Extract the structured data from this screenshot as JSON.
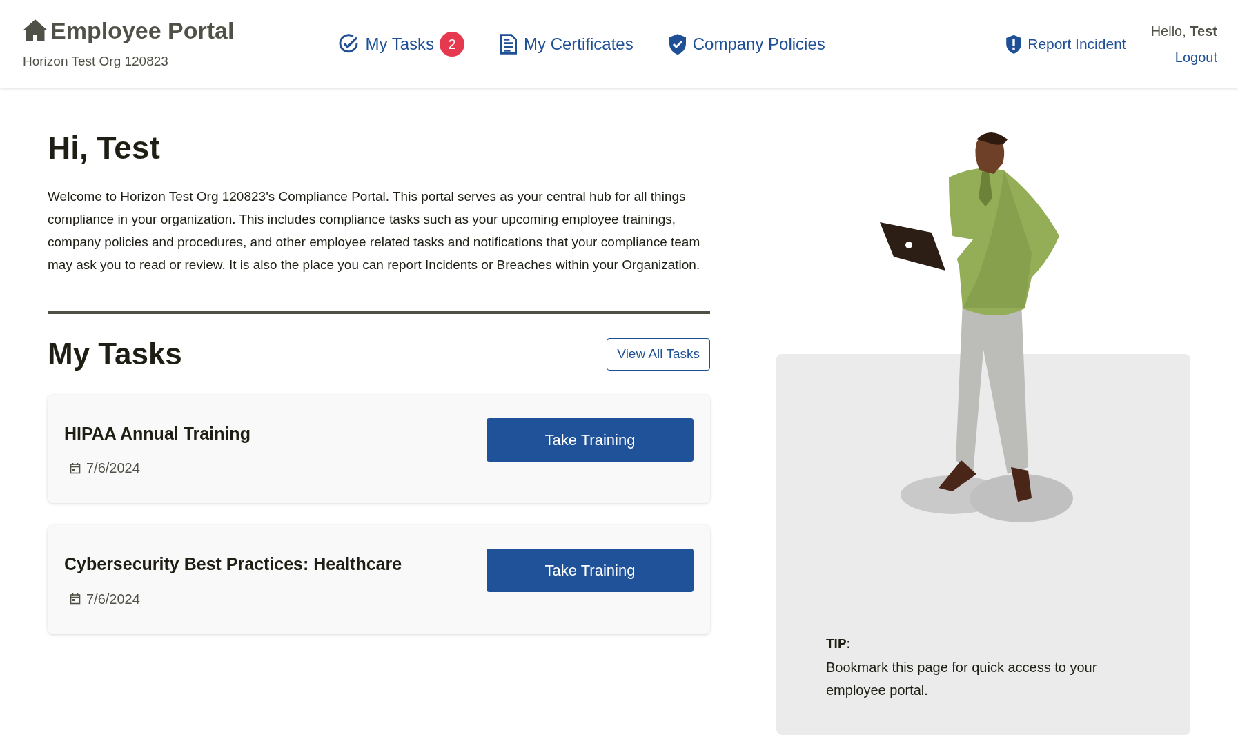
{
  "header": {
    "title": "Employee Portal",
    "org": "Horizon Test Org 120823",
    "nav": [
      {
        "label": "My Tasks",
        "kind": "tasks",
        "badge": "2"
      },
      {
        "label": "My Certificates",
        "kind": "certificates"
      },
      {
        "label": "Company Policies",
        "kind": "policies"
      }
    ],
    "report": "Report Incident",
    "greeting": "Hello, **Test**",
    "logout": "Logout"
  },
  "welcome": {
    "heading": "Hi, Test",
    "text": "Welcome to Horizon Test Org 120823's Compliance Portal. This portal serves as your central hub for all things compliance in your organization. This includes compliance tasks such as your upcoming employee trainings, company policies and procedures, and other employee related tasks and notifications that your compliance team may ask you to read or review. It is also the place you can report Incidents or Breaches within your Organization."
  },
  "tasks": {
    "heading": "My Tasks",
    "view_all": "View All Tasks",
    "items": [
      {
        "title": "HIPAA Annual Training",
        "date": "7/6/2024",
        "action": "Take Training"
      },
      {
        "title": "Cybersecurity Best Practices: Healthcare",
        "date": "7/6/2024",
        "action": "Take Training"
      }
    ]
  },
  "tip": {
    "label": "TIP:",
    "text": "Bookmark this page for quick access to your employee portal."
  }
}
